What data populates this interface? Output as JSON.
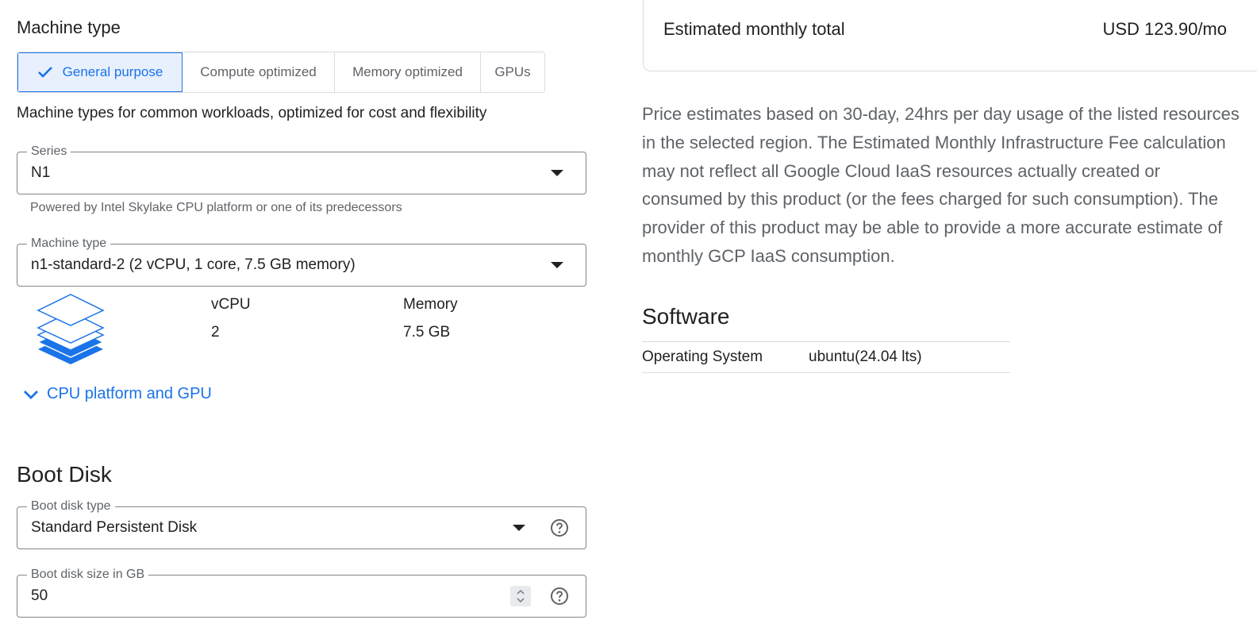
{
  "machine_section": {
    "title": "Machine type",
    "tabs": [
      {
        "label": "General purpose",
        "active": true
      },
      {
        "label": "Compute optimized",
        "active": false
      },
      {
        "label": "Memory optimized",
        "active": false
      },
      {
        "label": "GPUs",
        "active": false
      }
    ],
    "description": "Machine types for common workloads, optimized for cost and flexibility",
    "series": {
      "label": "Series",
      "value": "N1",
      "hint": "Powered by Intel Skylake CPU platform or one of its predecessors"
    },
    "machine_type": {
      "label": "Machine type",
      "value": "n1-standard-2 (2 vCPU, 1 core, 7.5 GB memory)"
    },
    "specs": {
      "vcpu_label": "vCPU",
      "vcpu_value": "2",
      "memory_label": "Memory",
      "memory_value": "7.5 GB"
    },
    "expand_label": "CPU platform and GPU"
  },
  "boot_disk": {
    "title": "Boot Disk",
    "disk_type": {
      "label": "Boot disk type",
      "value": "Standard Persistent Disk"
    },
    "disk_size": {
      "label": "Boot disk size in GB",
      "value": "50"
    }
  },
  "summary": {
    "total_label": "Estimated monthly total",
    "total_value": "USD 123.90/mo",
    "estimate_note": "Price estimates based on 30-day, 24hrs per day usage of the listed resources in the selected region. The Estimated Monthly Infrastructure Fee calculation may not reflect all Google Cloud IaaS resources actually created or consumed by this product (or the fees charged for such consumption). The provider of this product may be able to provide a more accurate estimate of monthly GCP IaaS consumption."
  },
  "software": {
    "title": "Software",
    "rows": [
      {
        "key": "Operating System",
        "value": "ubuntu(24.04 lts)"
      }
    ]
  },
  "colors": {
    "accent": "#1a73e8",
    "accent_bg": "#e8f0fe",
    "muted_text": "#5f6368",
    "border": "#dadce0"
  }
}
